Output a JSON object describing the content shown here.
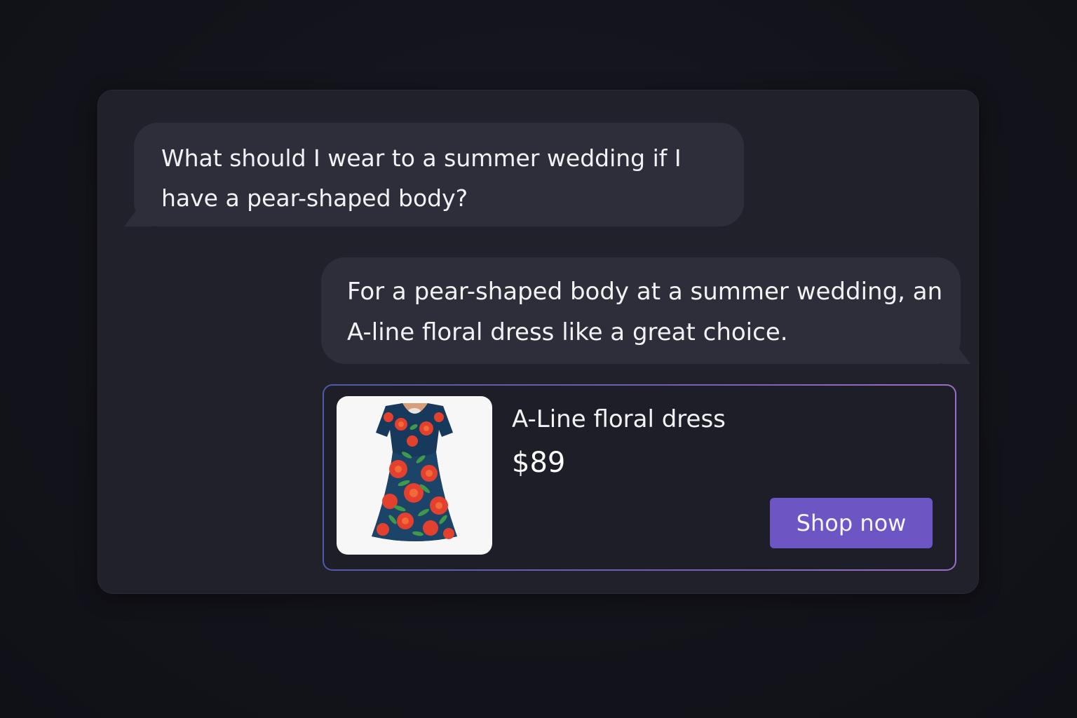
{
  "conversation": {
    "user_message": {
      "text": "What should I wear to a summer wedding if I have a pear-shaped body?"
    },
    "assistant_message": {
      "text": "For a pear-shaped body at a summer wedding, an  A-line floral dress like a great choice."
    }
  },
  "product": {
    "title": "A-Line floral dress",
    "price": "$89",
    "button_label": "Shop now",
    "image_icon": "floral-dress-image"
  },
  "colors": {
    "background": "#13131b",
    "panel": "#21212b",
    "bubble": "#2e2e3a",
    "button": "#6e55c4",
    "card_border_start": "#4d5aa8",
    "card_border_end": "#9a6fc8"
  }
}
